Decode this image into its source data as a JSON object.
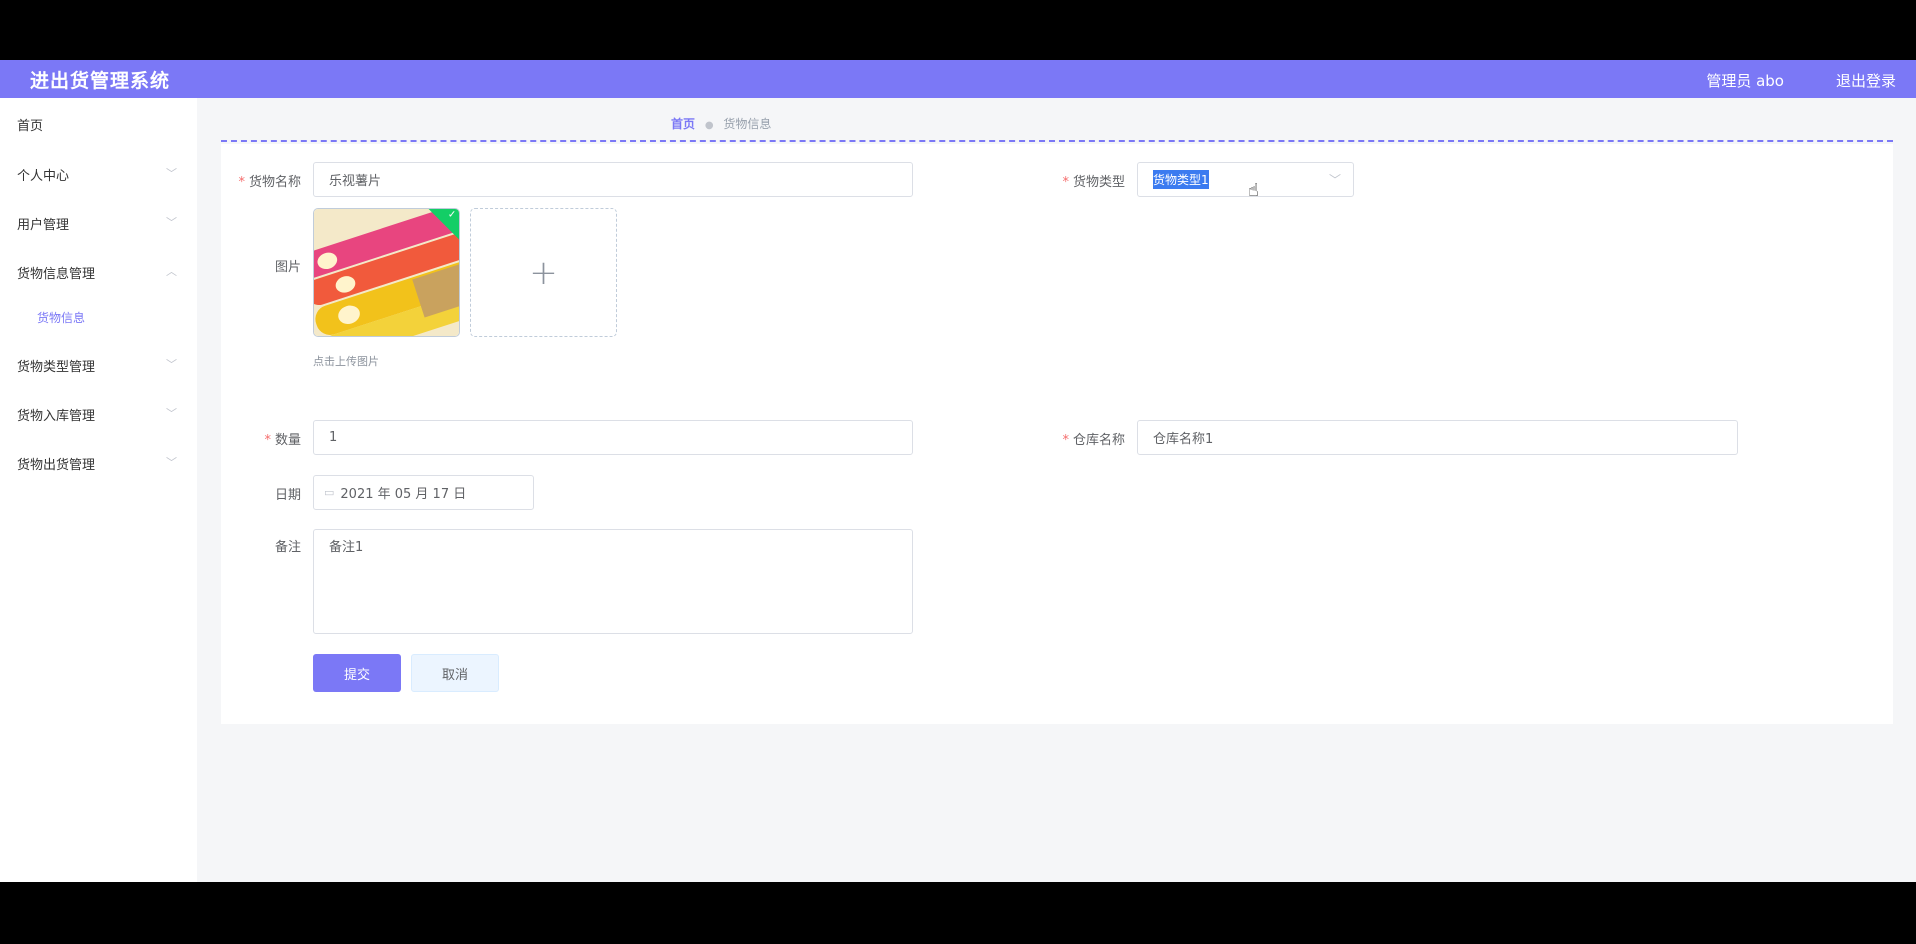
{
  "header": {
    "app_title": "进出货管理系统",
    "user_label": "管理员 abo",
    "logout_label": "退出登录"
  },
  "sidebar": {
    "items": [
      {
        "label": "首页"
      },
      {
        "label": "个人中心"
      },
      {
        "label": "用户管理"
      },
      {
        "label": "货物信息管理"
      },
      {
        "label": "货物类型管理"
      },
      {
        "label": "货物入库管理"
      },
      {
        "label": "货物出货管理"
      }
    ],
    "sub_item": "货物信息"
  },
  "breadcrumb": {
    "home": "首页",
    "current": "货物信息"
  },
  "form": {
    "name_label": "货物名称",
    "name_value": "乐视薯片",
    "type_label": "货物类型",
    "type_value": "货物类型1",
    "image_label": "图片",
    "upload_tip": "点击上传图片",
    "quantity_label": "数量",
    "quantity_value": "1",
    "warehouse_label": "仓库名称",
    "warehouse_value": "仓库名称1",
    "date_label": "日期",
    "date_value": "2021 年 05 月 17 日",
    "remark_label": "备注",
    "remark_value": "备注1",
    "submit_label": "提交",
    "cancel_label": "取消"
  },
  "colors": {
    "accent": "#7b78f6",
    "required": "#f56c6c",
    "success": "#13ce66"
  },
  "icons": [
    "plus-icon",
    "check-icon",
    "calendar-icon",
    "chevron-down-icon",
    "hand-pointer-icon"
  ]
}
